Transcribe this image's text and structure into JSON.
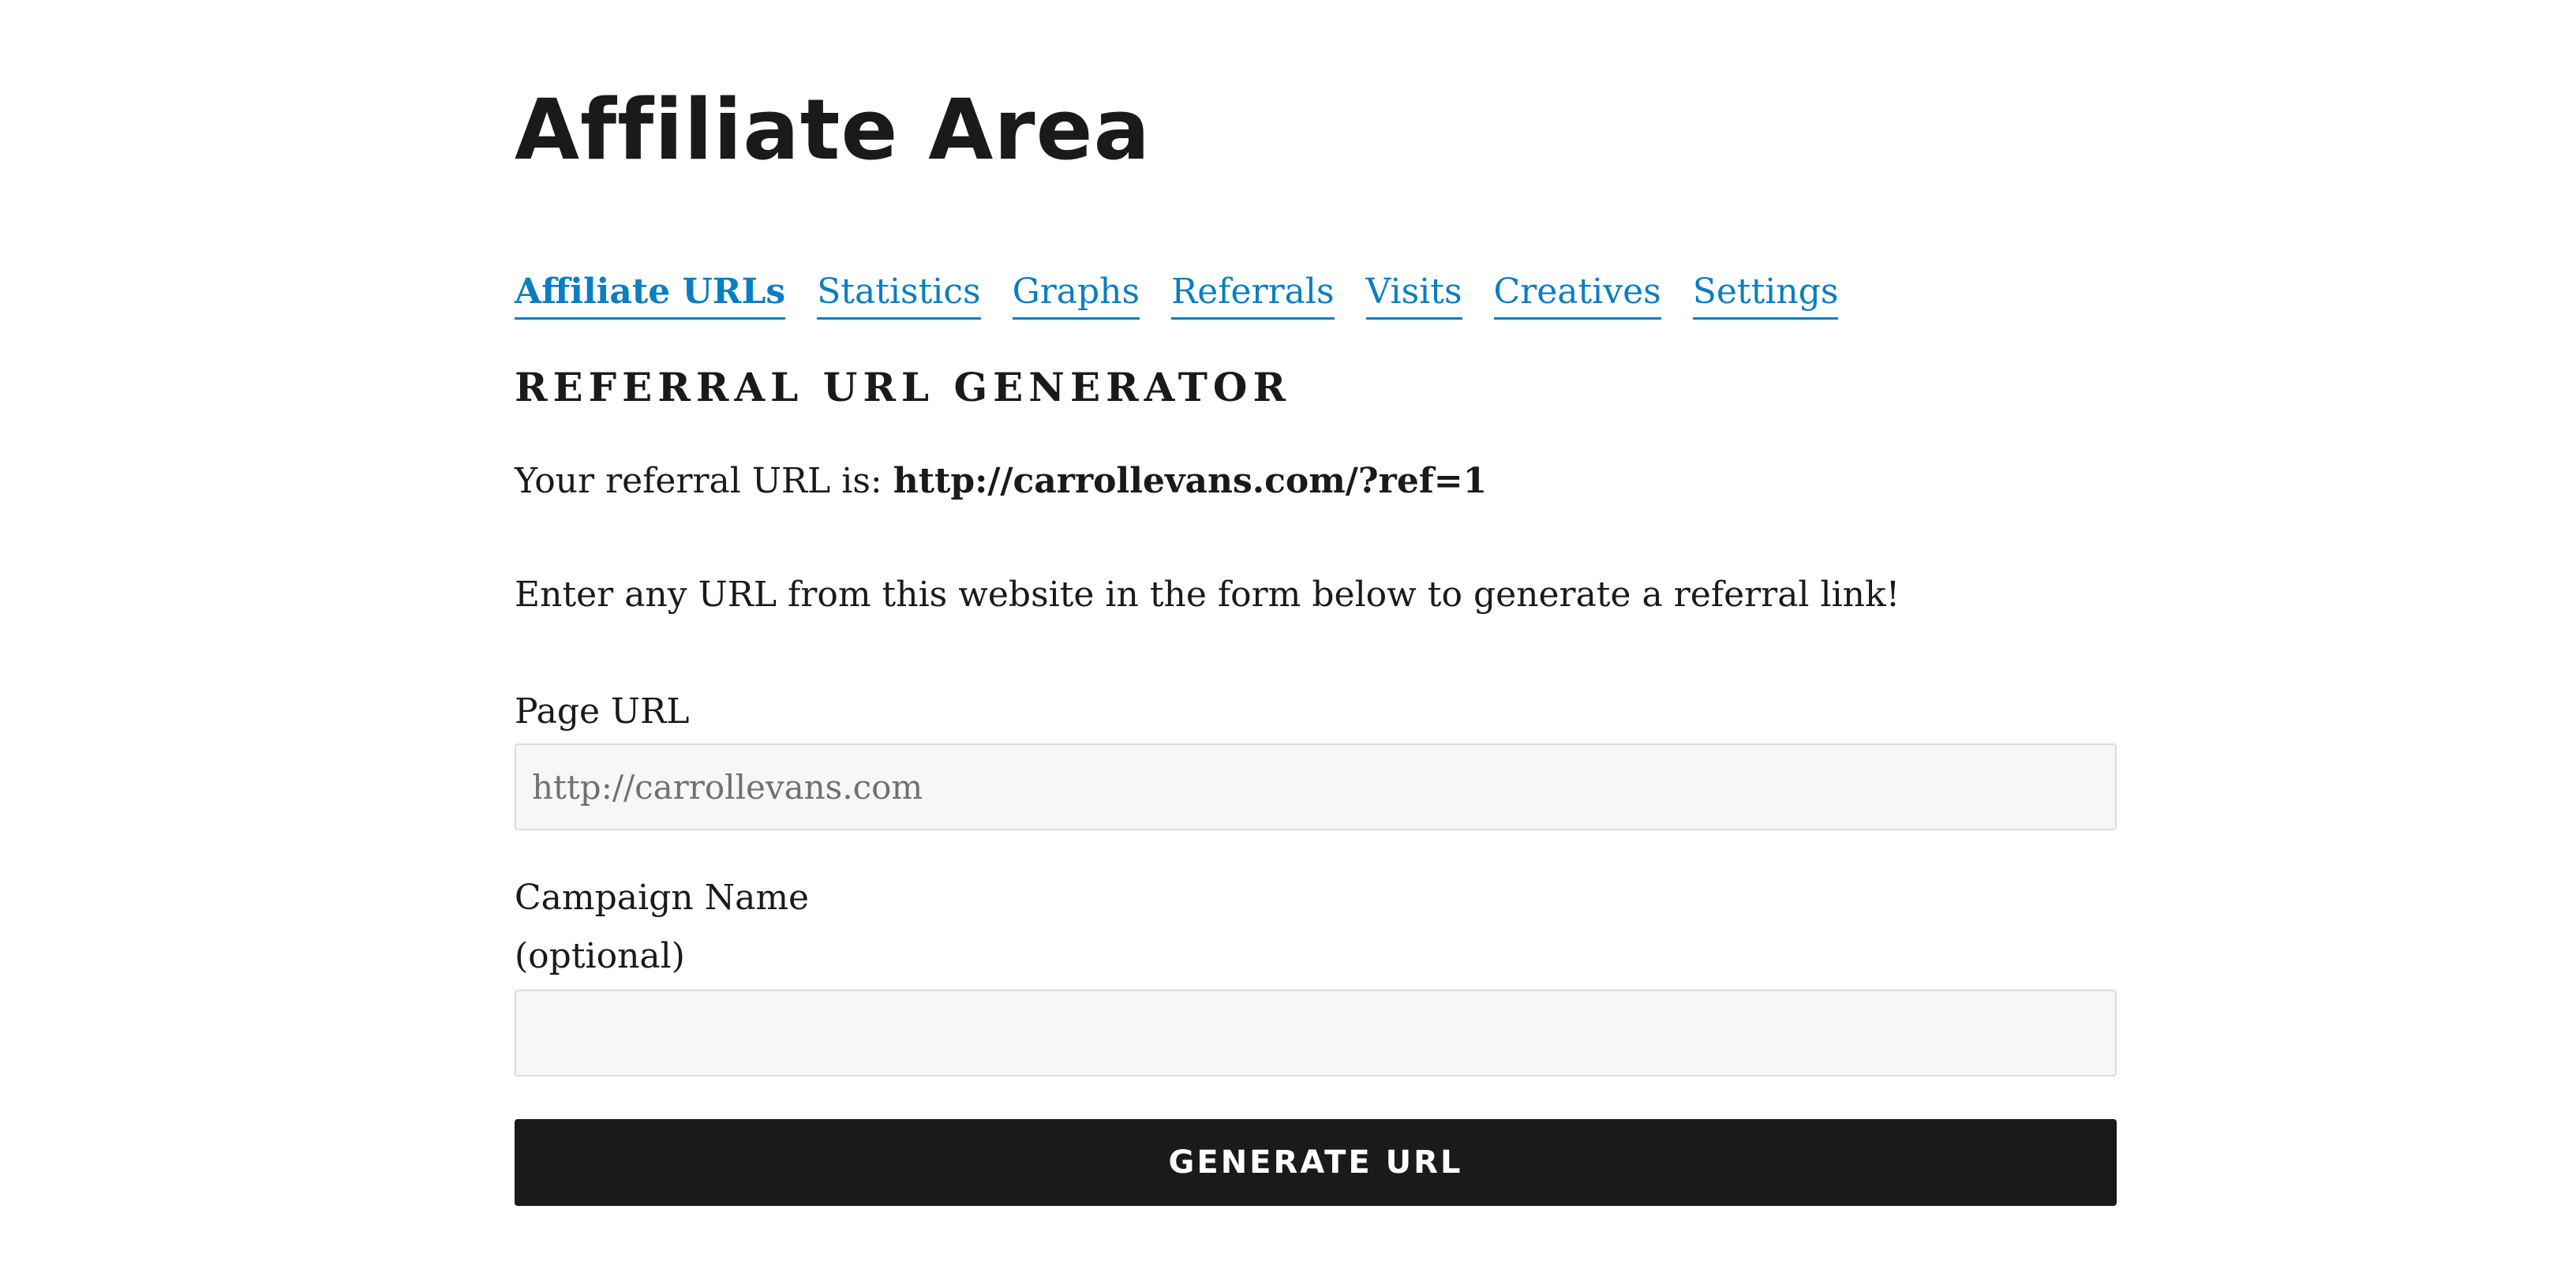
{
  "page": {
    "title": "Affiliate Area"
  },
  "tabs": [
    {
      "label": "Affiliate URLs",
      "active": true
    },
    {
      "label": "Statistics",
      "active": false
    },
    {
      "label": "Graphs",
      "active": false
    },
    {
      "label": "Referrals",
      "active": false
    },
    {
      "label": "Visits",
      "active": false
    },
    {
      "label": "Creatives",
      "active": false
    },
    {
      "label": "Settings",
      "active": false
    }
  ],
  "generator": {
    "heading": "REFERRAL URL GENERATOR",
    "referral_prefix": "Your referral URL is:",
    "referral_url": "http://carrollevans.com/?ref=1",
    "instructions": "Enter any URL from this website in the form below to generate a referral link!",
    "page_url_label": "Page URL",
    "page_url_placeholder": "http://carrollevans.com",
    "page_url_value": "",
    "campaign_label": "Campaign Name",
    "campaign_optional": "(optional)",
    "campaign_value": "",
    "submit_label": "GENERATE URL"
  },
  "colors": {
    "link": "#0a7ec2",
    "text": "#1a1a1a",
    "button_bg": "#1a1a1a",
    "button_text": "#ffffff",
    "field_bg": "#f7f7f7",
    "field_border": "#dcdcdc"
  }
}
